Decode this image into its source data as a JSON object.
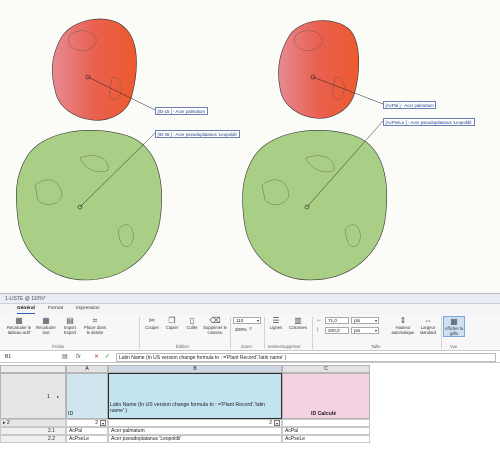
{
  "drawing": {
    "left_tags": [
      "[ID-15 ] - Acer palmatum",
      "[ID-36 ] - Acer pseudoplatanus 'Leopoldii'"
    ],
    "right_tags": [
      "[AcPal ] - Acer palmatum",
      "[AcPseLe ] - Acer pseudoplatanus 'Leopoldii'"
    ],
    "colors": {
      "red_tree": "#e8584a",
      "green_tree": "#a9cf86",
      "tag_text": "#1f3b8c"
    }
  },
  "window": {
    "title": "1-LISTE @ 110%*"
  },
  "ribbon": {
    "tabs": [
      "Général",
      "Format",
      "Impression"
    ],
    "buttons": {
      "recalc_table": "Recalculer le tableau actif",
      "recalc_all": "Recalculer tout",
      "import_export": "Import Export",
      "place_drawing": "Placer dans le dessin",
      "cut": "Couper",
      "copy": "Copier",
      "paste": "Coller",
      "delete_content": "Supprimer le contenu",
      "rows": "Lignes",
      "columns": "Colonnes",
      "auto_height": "Hauteur automatique",
      "std_width": "Largeur standard",
      "show_grid": "Afficher la grille"
    },
    "groups": {
      "file": "Fichier",
      "edit": "Édition",
      "zoom": "Zoom",
      "insert": "Insérer/supprimer",
      "size": "Taille",
      "view": "Vue"
    },
    "zoom_value": "110",
    "zoom_pct": "200%",
    "width_value": "71,0",
    "height_value": "200,0",
    "unit": "pts"
  },
  "formula_bar": {
    "cell_ref": "B1",
    "formula": "Latin Name (In US version change formula to : ='Plant Record'.'latin name' )"
  },
  "grid": {
    "columns": [
      "A",
      "B",
      "C"
    ],
    "header_row": {
      "number": "1",
      "a": "ID",
      "b": "Latin Name (In US version change formula to : ='Plant Record'.'latin name' )",
      "c": "ID Calculé"
    },
    "sub_row": {
      "number": "2",
      "a_sort": "2",
      "b_sort": "2"
    },
    "rows": [
      {
        "num": "2.1",
        "a": "AcPal",
        "b": "Acer palmatum",
        "c": "AcPal"
      },
      {
        "num": "2.2",
        "a": "AcPseLe",
        "b": "Acer pseudoplatanus 'Leopoldii'",
        "c": "AcPseLe"
      }
    ]
  }
}
